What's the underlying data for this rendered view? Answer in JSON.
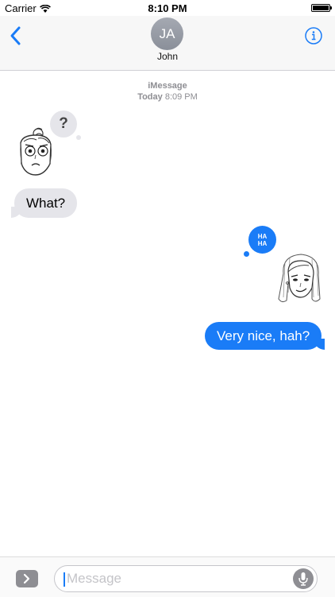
{
  "status": {
    "carrier": "Carrier",
    "time": "8:10 PM",
    "battery_level": 1.0
  },
  "nav": {
    "avatar_initials": "JA",
    "contact_name": "John"
  },
  "timestamp": {
    "service": "iMessage",
    "day": "Today",
    "time": "8:09 PM"
  },
  "messages": [
    {
      "direction": "incoming",
      "text": "What?"
    },
    {
      "direction": "outgoing",
      "text": "Very nice, hah?"
    }
  ],
  "stickers": {
    "incoming_thought": "?",
    "outgoing_thought": [
      "HA",
      "HA"
    ]
  },
  "composer": {
    "placeholder": "Message"
  },
  "colors": {
    "accent": "#1a7cf7",
    "incoming_bubble": "#e5e5ea",
    "timestamp": "#8e8e93"
  }
}
